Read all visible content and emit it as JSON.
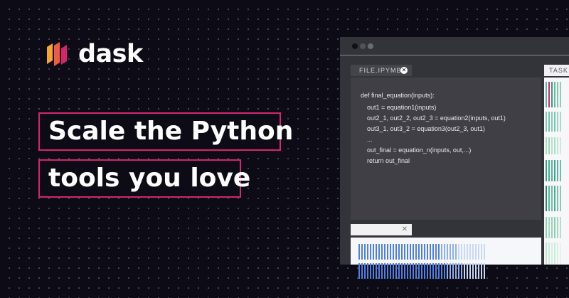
{
  "brand": {
    "name": "dask",
    "colors": [
      "#f8a62a",
      "#ef5a4a",
      "#d6246e"
    ]
  },
  "headline": {
    "line1": "Scale the Python",
    "line2": "tools you love",
    "accent": "#d6246e"
  },
  "window": {
    "file_tab": "FILE.IPYMB",
    "file_tab_close": "✕",
    "code": [
      "def final_equation(inputs):",
      "out1 = equation1(inputs)",
      "out2_1, out2_2, out2_3 = equation2(inputs, out1)",
      "out3_1, out3_2 = equation3(out2_3, out1)",
      "...",
      "out_final = equation_n(inputs, out,...)",
      "return out_final"
    ],
    "output_tab_close": "✕",
    "task_tab": "TASK"
  }
}
